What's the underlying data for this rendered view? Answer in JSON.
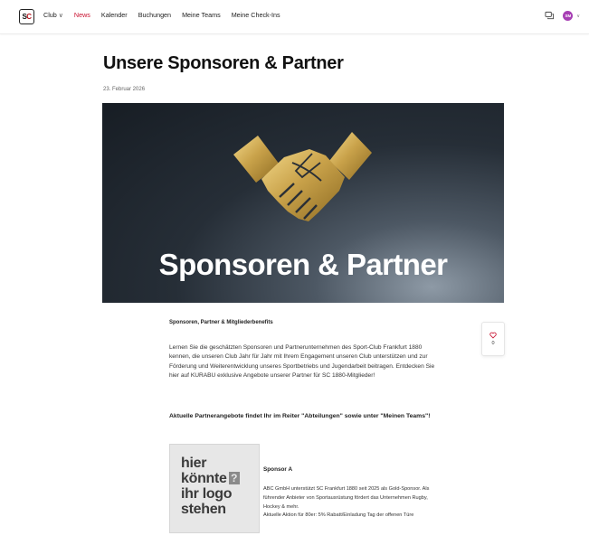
{
  "header": {
    "logo_text_s": "S",
    "logo_text_c": "C",
    "nav": [
      {
        "label": "Club",
        "has_dropdown": true,
        "active": false
      },
      {
        "label": "News",
        "active": true
      },
      {
        "label": "Kalender",
        "active": false
      },
      {
        "label": "Buchungen",
        "active": false
      },
      {
        "label": "Meine Teams",
        "active": false
      },
      {
        "label": "Meine Check-Ins",
        "active": false
      }
    ],
    "avatar_initials": "SM",
    "accent_color": "#c8102e",
    "avatar_color": "#a73fb4"
  },
  "article": {
    "title": "Unsere Sponsoren & Partner",
    "date": "23. Februar 2026",
    "hero_text": "Sponsoren & Partner",
    "sub_heading": "Sponsoren, Partner & Mitgliederbenefits",
    "intro": "Lernen Sie die geschätzten Sponsoren und Partnerunternehmen des Sport-Club Frankfurt 1880 kennen, die unseren Club Jahr für Jahr mit Ihrem Engagement unseren Club unterstützen und zur Förderung und Weiterentwicklung unseres Sportbetriebs und Jugendarbeit beitragen. Entdecken Sie hier auf KURABU exklusive Angebote unserer Partner für SC 1880-Mitglieder!",
    "offers_note": "Aktuelle Partnerangebote findet Ihr im Reiter \"Abteilungen\" sowie unter \"Meinen Teams\"!",
    "likes": "0"
  },
  "sponsor": {
    "logo_lines": [
      "hier",
      "könnte",
      "ihr logo",
      "stehen"
    ],
    "logo_qmark": "?",
    "name": "Sponsor A",
    "text": "ABC GmbH unterstützt SC Frankfurt 1880 seit 2025 als Gold-Sponsor. Als führender Anbieter von Sportausrüstung fördert das Unternehmen Rugby, Hockey & mehr.",
    "offer": "Aktuelle Aktion für 80er: 5% Rabatt/Einladung Tag der offenen Türe"
  }
}
